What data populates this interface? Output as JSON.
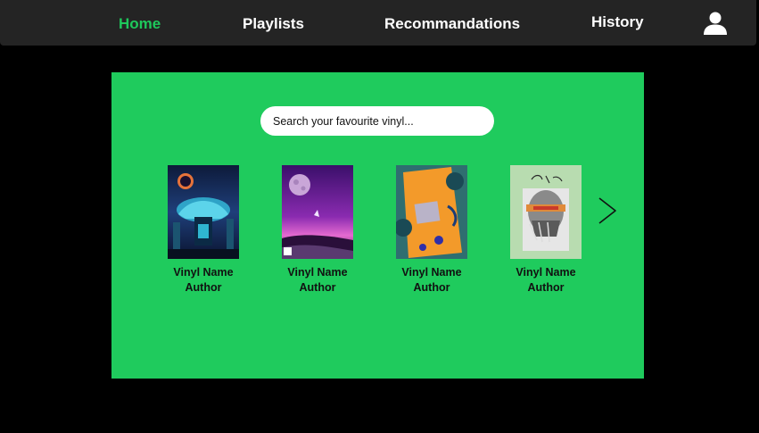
{
  "nav": {
    "home": "Home",
    "playlists": "Playlists",
    "recommandations": "Recommandations",
    "history": "History",
    "profile_icon": "user-icon",
    "active_color": "#1ec85b"
  },
  "search": {
    "placeholder": "Search your favourite vinyl..."
  },
  "vinyls": [
    {
      "name": "Vinyl Name",
      "author": "Author",
      "cover_icon": "album-cover-neon-city"
    },
    {
      "name": "Vinyl Name",
      "author": "Author",
      "cover_icon": "album-cover-moon-beach"
    },
    {
      "name": "Vinyl Name",
      "author": "Author",
      "cover_icon": "album-cover-orange-abstract"
    },
    {
      "name": "Vinyl Name",
      "author": "Author",
      "cover_icon": "album-cover-sketch-portrait"
    }
  ],
  "carousel": {
    "next_icon": "chevron-right-icon"
  },
  "colors": {
    "background": "#000000",
    "navbar": "#242424",
    "panel": "#1fcb5d"
  }
}
